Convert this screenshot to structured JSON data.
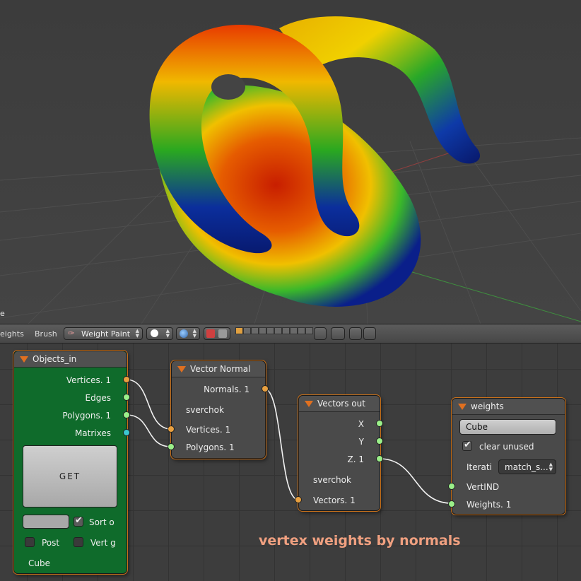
{
  "viewport": {
    "bottom_left_label": "e"
  },
  "header": {
    "menu_weights": "eights",
    "menu_brush": "Brush",
    "mode_select": "Weight Paint",
    "icons": [
      "weight-paint-mode-icon",
      "shading-sphere-icon",
      "pivot-icon",
      "manipulator-icon",
      "layers-grid-icon",
      "layers-grid-2-icon",
      "lock-icon",
      "render-icon",
      "camera-icon",
      "clapper-icon"
    ]
  },
  "node_editor": {
    "overlay_text": "vertex weights by normals",
    "colors": {
      "objects_in_bg": "#0f6b2b",
      "node_outline": "#c8701a",
      "socket_orange": "#e8a040",
      "socket_green": "#9bf08a",
      "socket_cyan": "#3cc8d0"
    },
    "objects_in": {
      "title": "Objects_in",
      "outputs": [
        "Vertices. 1",
        "Edges",
        "Polygons. 1",
        "Matrixes"
      ],
      "get_button": "GET",
      "sort_label": "Sort o",
      "post_label": "Post",
      "vert_label": "Vert g",
      "object_name": "Cube",
      "sort_checked": true,
      "post_checked": false,
      "vert_checked": false
    },
    "vector_normal": {
      "title": "Vector Normal",
      "output": "Normals. 1",
      "text": "sverchok",
      "inputs": [
        "Vertices. 1",
        "Polygons. 1"
      ]
    },
    "vectors_out": {
      "title": "Vectors out",
      "outputs": [
        "X",
        "Y",
        "Z. 1"
      ],
      "text": "sverchok",
      "input": "Vectors. 1"
    },
    "weights": {
      "title": "weights",
      "object_field": "Cube",
      "clear_unused_label": "clear unused",
      "clear_unused_checked": true,
      "iter_label": "Iterati",
      "iter_value": "match_s...",
      "inputs": [
        "VertIND",
        "Weights. 1"
      ]
    }
  }
}
